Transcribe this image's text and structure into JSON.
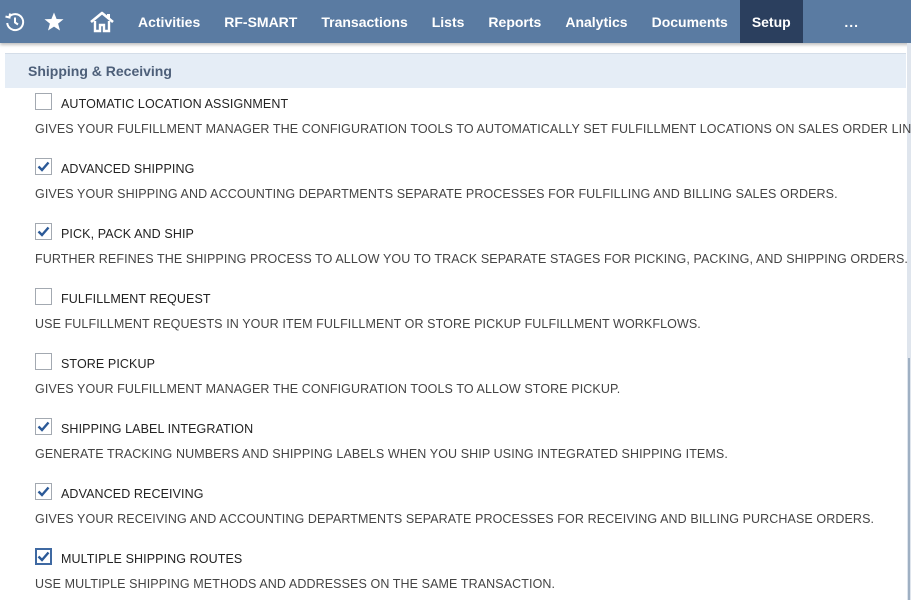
{
  "nav": {
    "icons": [
      "recent-records-icon",
      "star-icon",
      "home-icon"
    ],
    "items": [
      {
        "label": "Activities"
      },
      {
        "label": "RF-SMART"
      },
      {
        "label": "Transactions"
      },
      {
        "label": "Lists"
      },
      {
        "label": "Reports"
      },
      {
        "label": "Analytics"
      },
      {
        "label": "Documents"
      },
      {
        "label": "Setup",
        "active": true
      },
      {
        "label": "..."
      }
    ]
  },
  "section": {
    "title": "Shipping & Receiving"
  },
  "options": [
    {
      "label": "AUTOMATIC LOCATION ASSIGNMENT",
      "checked": false,
      "description": "GIVES YOUR FULFILLMENT MANAGER THE CONFIGURATION TOOLS TO AUTOMATICALLY SET FULFILLMENT LOCATIONS ON SALES ORDER LINES."
    },
    {
      "label": "ADVANCED SHIPPING",
      "checked": true,
      "description": "GIVES YOUR SHIPPING AND ACCOUNTING DEPARTMENTS SEPARATE PROCESSES FOR FULFILLING AND BILLING SALES ORDERS."
    },
    {
      "label": "PICK, PACK AND SHIP",
      "checked": true,
      "description": "FURTHER REFINES THE SHIPPING PROCESS TO ALLOW YOU TO TRACK SEPARATE STAGES FOR PICKING, PACKING, AND SHIPPING ORDERS."
    },
    {
      "label": "FULFILLMENT REQUEST",
      "checked": false,
      "description": "USE FULFILLMENT REQUESTS IN YOUR ITEM FULFILLMENT OR STORE PICKUP FULFILLMENT WORKFLOWS."
    },
    {
      "label": "STORE PICKUP",
      "checked": false,
      "description": "GIVES YOUR FULFILLMENT MANAGER THE CONFIGURATION TOOLS TO ALLOW STORE PICKUP."
    },
    {
      "label": "SHIPPING LABEL INTEGRATION",
      "checked": true,
      "description": "GENERATE TRACKING NUMBERS AND SHIPPING LABELS WHEN YOU SHIP USING INTEGRATED SHIPPING ITEMS."
    },
    {
      "label": "ADVANCED RECEIVING",
      "checked": true,
      "description": "GIVES YOUR RECEIVING AND ACCOUNTING DEPARTMENTS SEPARATE PROCESSES FOR RECEIVING AND BILLING PURCHASE ORDERS."
    },
    {
      "label": "MULTIPLE SHIPPING ROUTES",
      "checked": true,
      "focused": true,
      "description": "USE MULTIPLE SHIPPING METHODS AND ADDRESSES ON THE SAME TRANSACTION."
    }
  ]
}
